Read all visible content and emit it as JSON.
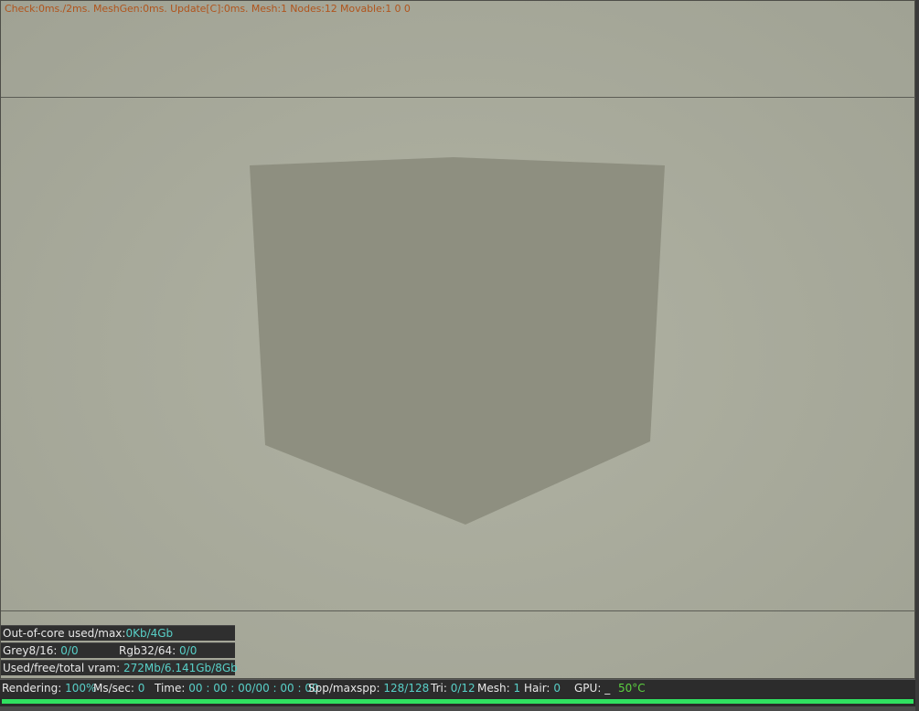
{
  "viewport": {
    "debug_line": "Check:0ms./2ms. MeshGen:0ms. Update[C]:0ms. Mesh:1 Nodes:12 Movable:1  0 0",
    "object_color": "#8e8f80",
    "background_color": "#aaac9d"
  },
  "memory_panel": {
    "out_of_core_label": "Out-of-core used/max:",
    "out_of_core_value": "0Kb/4Gb",
    "grey_label": "Grey8/16:",
    "grey_value": "0/0",
    "rgb_label": "Rgb32/64:",
    "rgb_value": "0/0",
    "vram_label": "Used/free/total vram:",
    "vram_value": "272Mb/6.141Gb/8Gb"
  },
  "status_bar": {
    "rendering_label": "Rendering:",
    "rendering_value": "100%",
    "ms_label": "Ms/sec:",
    "ms_value": "0",
    "time_label": "Time:",
    "time_value": "00 : 00 : 00/00 : 00 : 00",
    "spp_label": "Spp/maxspp:",
    "spp_value": "128/128",
    "tri_label": "Tri:",
    "tri_value": "0/12",
    "mesh_label": "Mesh:",
    "mesh_value": "1",
    "hair_label": "Hair:",
    "hair_value": "0",
    "gpu_label": "GPU:",
    "gpu_value": "_",
    "temp_value": "50°C",
    "progress_fraction": 1.0,
    "progress_color": "#30e060",
    "temp_color": "#5cd040"
  }
}
